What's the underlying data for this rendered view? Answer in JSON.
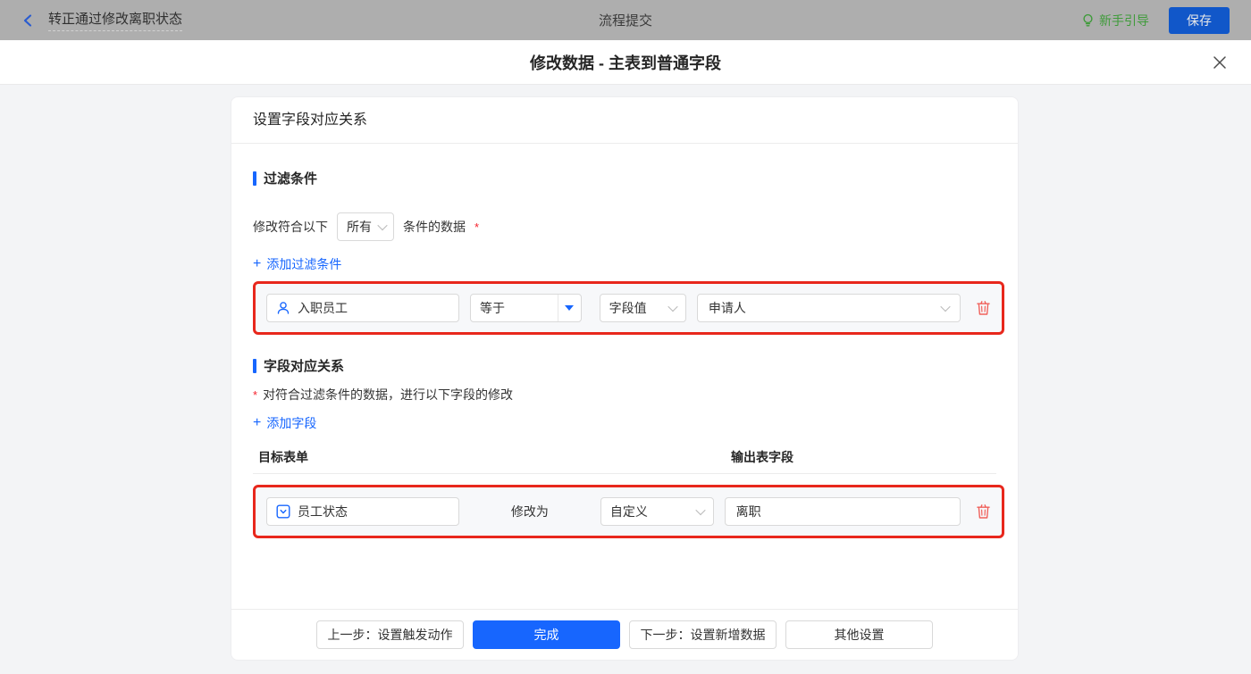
{
  "icons": {
    "plus": "+"
  },
  "topbar": {
    "flow_title": "转正通过修改离职状态",
    "center_title": "流程提交",
    "guide_label": "新手引导",
    "save_label": "保存"
  },
  "modal": {
    "title": "修改数据 - 主表到普通字段",
    "card_header": "设置字段对应关系",
    "filter_section": {
      "title": "过滤条件",
      "match_prefix": "修改符合以下",
      "match_scope_value": "所有",
      "match_suffix": "条件的数据",
      "required_mark": "*",
      "add_link_label": "添加过滤条件",
      "row": {
        "field_value": "入职员工",
        "operator_value": "等于",
        "value_type_value": "字段值",
        "value_value": "申请人"
      }
    },
    "mapping_section": {
      "title": "字段对应关系",
      "required_mark": "*",
      "description": "对符合过滤条件的数据，进行以下字段的修改",
      "add_link_label": "添加字段",
      "column_target": "目标表单",
      "column_output": "输出表字段",
      "row": {
        "field_value": "员工状态",
        "action_label": "修改为",
        "mode_value": "自定义",
        "value_value": "离职"
      }
    },
    "footer": {
      "prev_label": "上一步：设置触发动作",
      "done_label": "完成",
      "next_label": "下一步：设置新增数据",
      "other_label": "其他设置"
    }
  },
  "colors": {
    "accent_blue": "#1766fe",
    "annotation_red": "#e8271c",
    "danger_red": "#f0605a",
    "guide_green": "#3f9b3a"
  }
}
